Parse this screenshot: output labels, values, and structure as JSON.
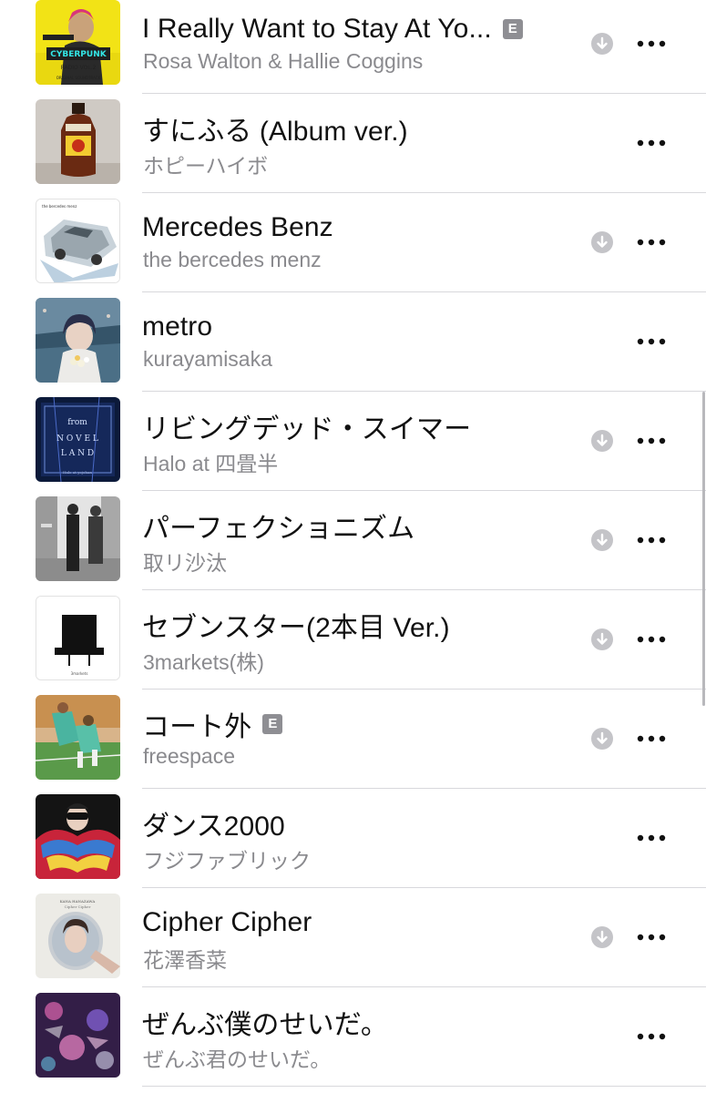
{
  "songs": [
    {
      "title": "I Really Want to Stay At Yo...",
      "artist": "Rosa Walton & Hallie Coggins",
      "explicit": true,
      "downloaded": true,
      "artwork": "cyberpunk-radio-cover"
    },
    {
      "title": "すにふる (Album ver.)",
      "artist": "ホピーハイボ",
      "explicit": false,
      "downloaded": false,
      "artwork": "bottle-cover"
    },
    {
      "title": "Mercedes Benz",
      "artist": "the bercedes menz",
      "explicit": false,
      "downloaded": true,
      "artwork": "car-cover"
    },
    {
      "title": "metro",
      "artist": "kurayamisaka",
      "explicit": false,
      "downloaded": false,
      "artwork": "anime-girl-cover"
    },
    {
      "title": "リビングデッド・スイマー",
      "artist": "Halo at 四畳半",
      "explicit": false,
      "downloaded": true,
      "artwork": "from-novel-land-cover"
    },
    {
      "title": "パーフェクショニズム",
      "artist": "取リ沙汰",
      "explicit": false,
      "downloaded": true,
      "artwork": "street-photo-cover"
    },
    {
      "title": "セブンスター(2本目 Ver.)",
      "artist": "3markets(株)",
      "explicit": false,
      "downloaded": true,
      "artwork": "black-hat-cover"
    },
    {
      "title": "コート外",
      "artist": "freespace",
      "explicit": true,
      "downloaded": true,
      "artwork": "tennis-court-cover"
    },
    {
      "title": "ダンス2000",
      "artist": "フジファブリック",
      "explicit": false,
      "downloaded": false,
      "artwork": "feather-costume-cover"
    },
    {
      "title": "Cipher Cipher",
      "artist": "花澤香菜",
      "explicit": false,
      "downloaded": true,
      "artwork": "mirror-portrait-cover"
    },
    {
      "title": "ぜんぶ僕のせいだ。",
      "artist": "ぜんぶ君のせいだ。",
      "explicit": false,
      "downloaded": false,
      "artwork": "pink-glitter-cover"
    }
  ],
  "labels": {
    "explicit_badge": "E"
  },
  "icons": {
    "download": "download-arrow-icon",
    "more": "more-ellipsis-icon"
  },
  "colors": {
    "title_text": "#111111",
    "artist_text": "#8a8a8e",
    "download_icon": "#c4c4c8",
    "more_icon": "#111111",
    "divider": "#d8d8dc",
    "explicit_badge": "#8e8e93"
  }
}
